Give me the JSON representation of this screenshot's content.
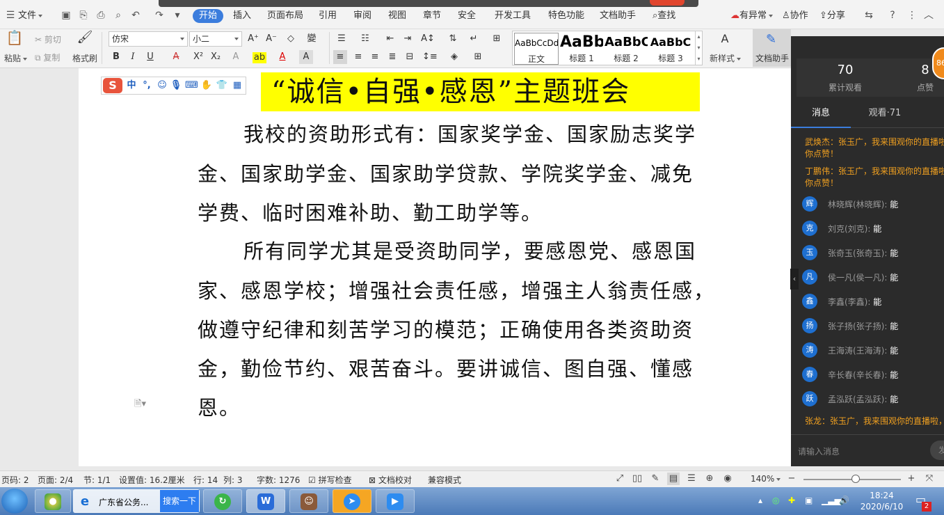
{
  "menu": {
    "file": "文件",
    "tabs": [
      "开始",
      "插入",
      "页面布局",
      "引用",
      "审阅",
      "视图",
      "章节",
      "安全",
      "开发工具",
      "特色功能",
      "文档助手"
    ],
    "search": "查找",
    "anomaly": "有异常",
    "collab": "协作",
    "share": "分享"
  },
  "ribbon": {
    "paste": "粘贴",
    "cut": "剪切",
    "copy": "复制",
    "format_painter": "格式刷",
    "font": "仿宋",
    "size": "小二",
    "styles": [
      {
        "sample": "AaBbCcDd",
        "label": "正文"
      },
      {
        "sample": "AaBb",
        "label": "标题 1"
      },
      {
        "sample": "AaBbC",
        "label": "标题 2"
      },
      {
        "sample": "AaBbC",
        "label": "标题 3"
      }
    ],
    "new_style": "新样式",
    "doc_assistant": "文档助手"
  },
  "document": {
    "title": "“诚信•自强•感恩”主题班会",
    "lines": [
      "我校的资助形式有：国家奖学金、国家励志奖学",
      "金、国家助学金、国家助学贷款、学院奖学金、减免",
      "学费、临时困难补助、勤工助学等。",
      "所有同学尤其是受资助同学，要感恩党、感恩国",
      "家、感恩学校；增强社会责任感，增强主人翁责任感，",
      "做遵守纪律和刻苦学习的模范；正确使用各类资助资",
      "金，勤俭节约、艰苦奋斗。要讲诚信、图自强、懂感",
      "恩。"
    ]
  },
  "ime": {
    "logo": "S",
    "mode": "中",
    "punct": "°,"
  },
  "live": {
    "total_views": "70",
    "total_views_label": "累计观看",
    "likes": "8",
    "likes_label": "点赞",
    "tab_messages": "消息",
    "tab_watching": "观看·71",
    "badge": "86",
    "msgs_top": [
      {
        "line1": "武焕杰：张玉广，我来围观你的直播啦",
        "line2": "你点赞！"
      },
      {
        "line1": "丁鹏伟：张玉广，我来围观你的直播啦",
        "line2": "你点赞！"
      }
    ],
    "users": [
      {
        "avatar": "辉",
        "name": "林晓辉(林晓辉):",
        "reply": "能"
      },
      {
        "avatar": "克",
        "name": "刘克(刘克):",
        "reply": "能"
      },
      {
        "avatar": "玉",
        "name": "张奇玉(张奇玉):",
        "reply": "能"
      },
      {
        "avatar": "凡",
        "name": "侯一凡(侯一凡):",
        "reply": "能"
      },
      {
        "avatar": "鑫",
        "name": "李鑫(李鑫):",
        "reply": "能"
      },
      {
        "avatar": "扬",
        "name": "张子扬(张子扬):",
        "reply": "能"
      },
      {
        "avatar": "涛",
        "name": "王海涛(王海涛):",
        "reply": "能"
      },
      {
        "avatar": "春",
        "name": "辛长春(辛长春):",
        "reply": "能"
      },
      {
        "avatar": "跃",
        "name": "孟泓跃(孟泓跃):",
        "reply": "能"
      }
    ],
    "msg_bottom": "张龙：张玉广，我来围观你的直播啦，",
    "input_placeholder": "请输入消息",
    "send": "发"
  },
  "status": {
    "page_code": "页码: 2",
    "page": "页面: 2/4",
    "section": "节: 1/1",
    "setting": "设置值: 16.2厘米",
    "row": "行: 14",
    "col": "列: 3",
    "words": "字数: 1276",
    "spell": "拼写检查",
    "proof": "文档校对",
    "compat": "兼容模式",
    "zoom": "140%"
  },
  "taskbar": {
    "ie_title": "广东省公务...",
    "search_btn": "搜索一下",
    "time": "18:24",
    "date": "2020/6/10",
    "notif_count": "2"
  }
}
